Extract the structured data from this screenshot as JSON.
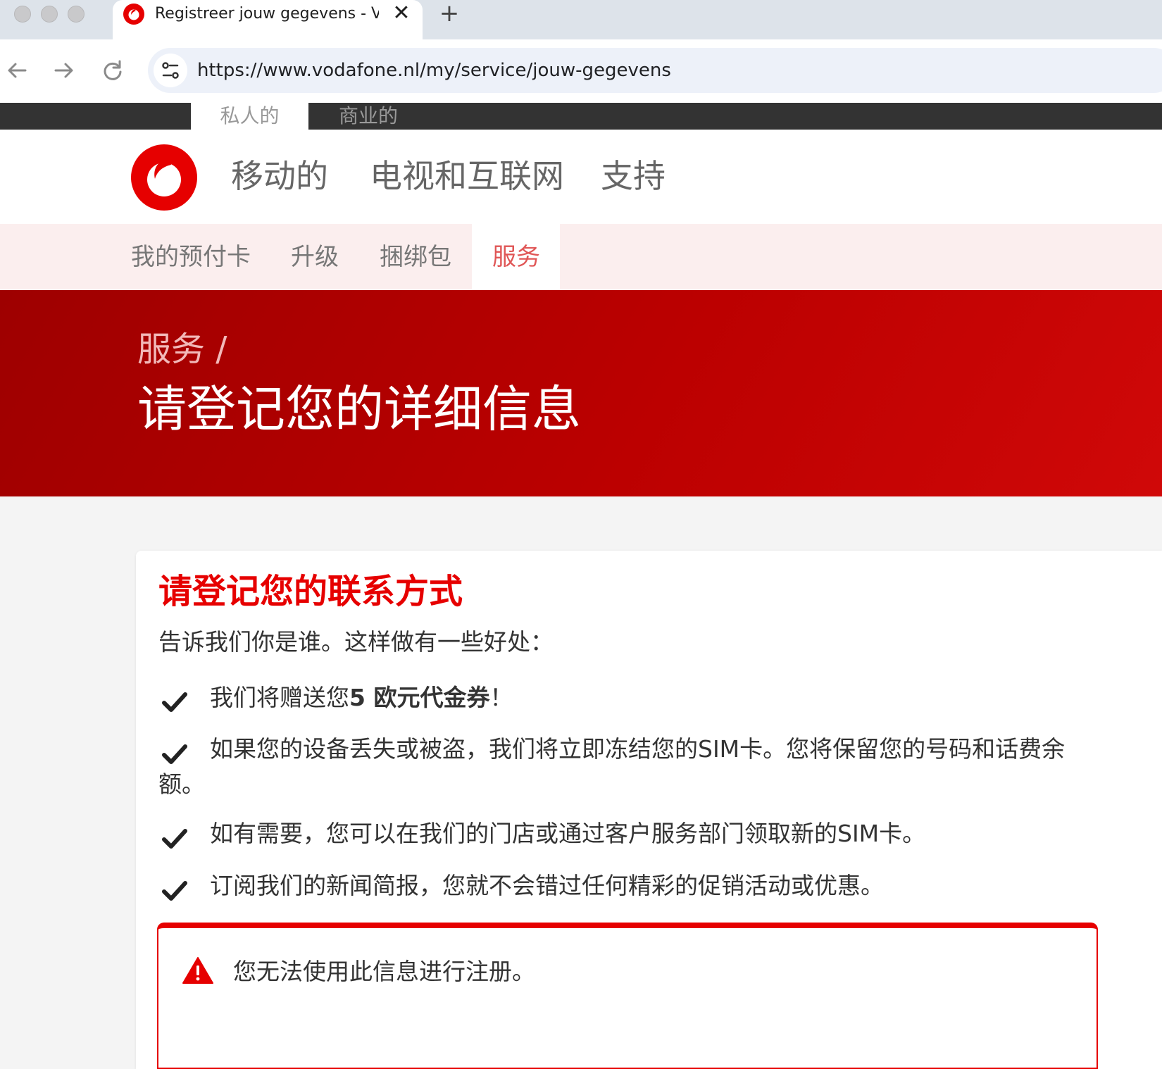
{
  "browser": {
    "tab_title": "Registreer jouw gegevens - Vodafone",
    "tab_close": "✕",
    "new_tab": "+",
    "url": "https://www.vodafone.nl/my/service/jouw-gegevens"
  },
  "segments": {
    "private": "私人的",
    "business": "商业的"
  },
  "mainnav": {
    "mobile": "移动的",
    "tv_internet": "电视和互联网",
    "support": "支持"
  },
  "subnav": {
    "prepaid": "我的预付卡",
    "upgrade": "升级",
    "bundles": "捆绑包",
    "service": "服务"
  },
  "hero": {
    "breadcrumb": "服务 /",
    "title": "请登记您的详细信息"
  },
  "card": {
    "title": "请登记您的联系方式",
    "intro": "告诉我们你是谁。这样做有一些好处：",
    "benefit1_pre": "我们将赠送您",
    "benefit1_bold": "5 欧元代金券",
    "benefit1_post": "！",
    "benefit2_line1": "如果您的设备丢失或被盗，我们将立即冻结您的SIM卡。您将保留您的号码和话费余",
    "benefit2_line2": "额。",
    "benefit3": "如有需要，您可以在我们的门店或通过客户服务部门领取新的SIM卡。",
    "benefit4": "订阅我们的新闻简报，您就不会错过任何精彩的促销活动或优惠。"
  },
  "alert": {
    "text": "您无法使用此信息进行注册。"
  },
  "colors": {
    "brand_red": "#e60000",
    "hero_dark": "#9e0000",
    "topbar": "#333333"
  },
  "icons": [
    "vodafone-favicon-icon",
    "close-icon",
    "plus-icon",
    "back-arrow-icon",
    "forward-arrow-icon",
    "reload-icon",
    "site-settings-icon",
    "vodafone-logo-icon",
    "checkmark-icon",
    "warning-icon"
  ]
}
